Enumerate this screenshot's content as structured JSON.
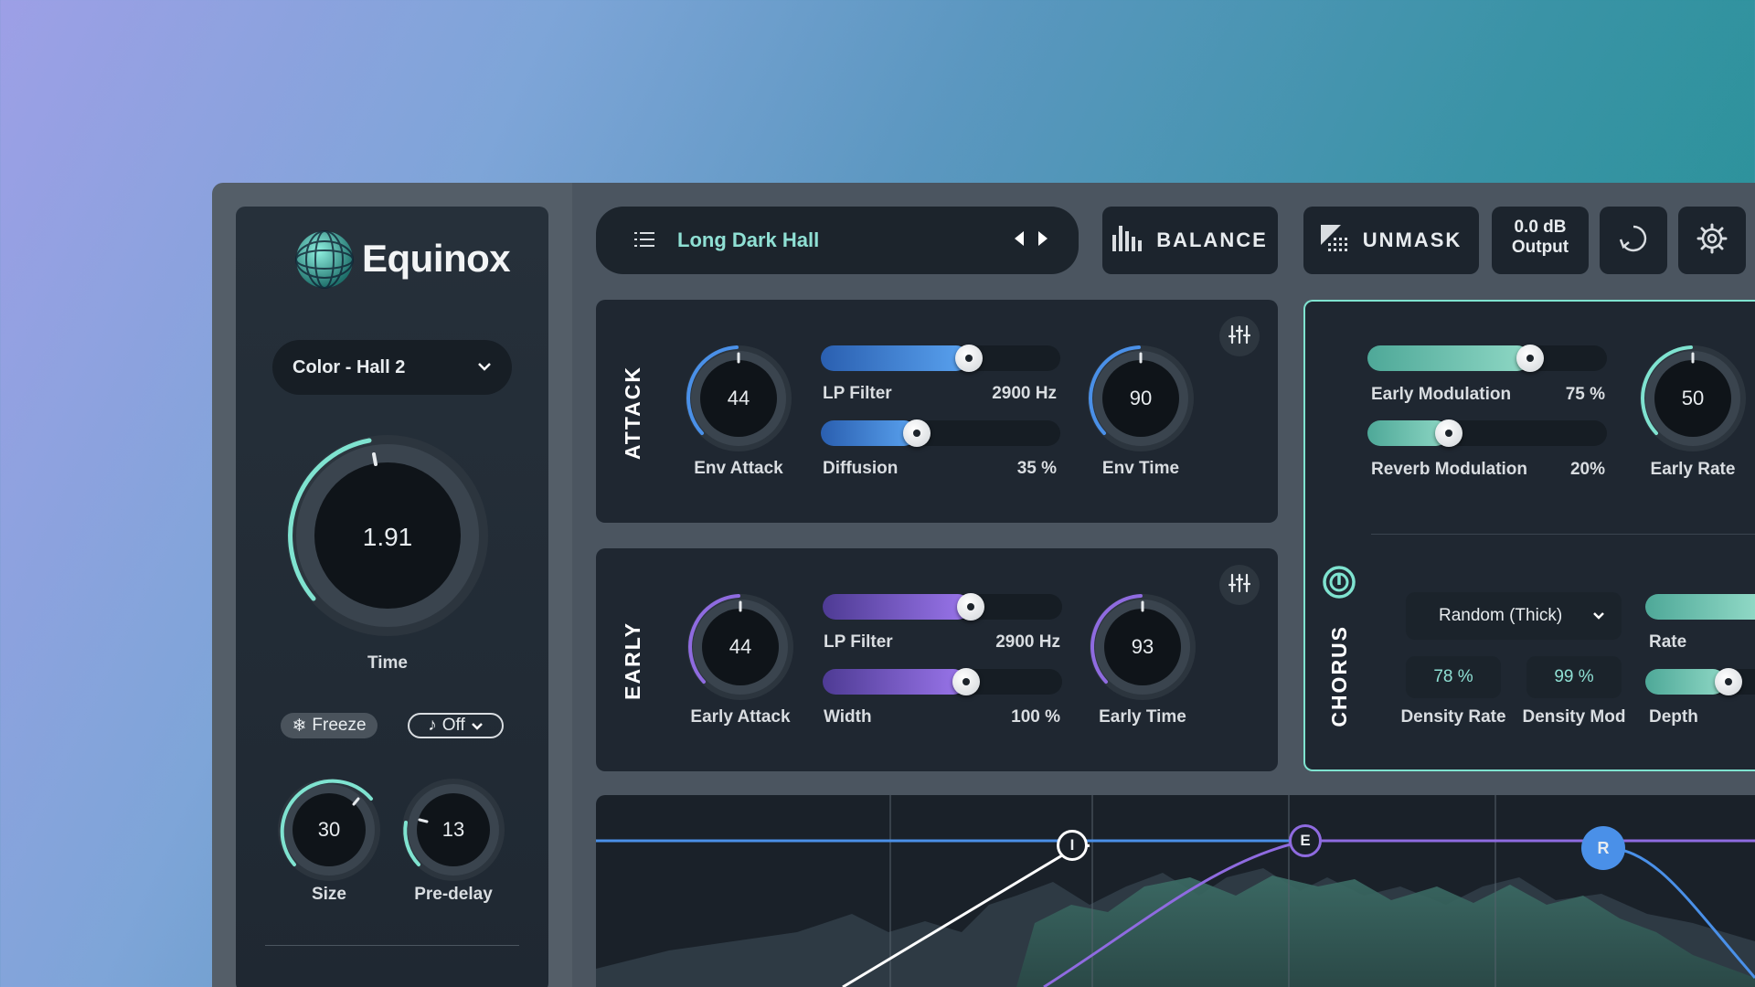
{
  "app": {
    "name": "Equinox"
  },
  "left": {
    "color_preset": "Color - Hall 2",
    "time": {
      "value": "1.91",
      "label": "Time"
    },
    "freeze_label": "Freeze",
    "sync_label": "Off",
    "size": {
      "value": "30",
      "label": "Size"
    },
    "predelay": {
      "value": "13",
      "label": "Pre-delay"
    }
  },
  "topbar": {
    "preset_name": "Long Dark Hall",
    "balance_label": "BALANCE",
    "unmask_label": "UNMASK",
    "output_value": "0.0 dB",
    "output_label": "Output"
  },
  "attack": {
    "title": "ATTACK",
    "env_attack": {
      "value": "44",
      "label": "Env Attack"
    },
    "lp_filter": {
      "label": "LP Filter",
      "value": "2900 Hz",
      "level": 0.62
    },
    "diffusion": {
      "label": "Diffusion",
      "value": "35 %",
      "level": 0.4
    },
    "env_time": {
      "value": "90",
      "label": "Env Time"
    }
  },
  "early": {
    "title": "EARLY",
    "early_attack": {
      "value": "44",
      "label": "Early Attack"
    },
    "lp_filter": {
      "label": "LP Filter",
      "value": "2900 Hz",
      "level": 0.62
    },
    "width": {
      "label": "Width",
      "value": "100 %",
      "level": 0.6
    },
    "early_time": {
      "value": "93",
      "label": "Early Time"
    }
  },
  "chorus": {
    "title": "CHORUS",
    "early_modulation": {
      "label": "Early Modulation",
      "value": "75 %",
      "level": 0.68
    },
    "reverb_modulation": {
      "label": "Reverb Modulation",
      "value": "20%",
      "level": 0.34
    },
    "early_rate": {
      "value": "50",
      "label": "Early Rate"
    },
    "mode": "Random (Thick)",
    "density_rate": {
      "value": "78 %",
      "label": "Density Rate"
    },
    "density_mod": {
      "value": "99 %",
      "label": "Density Mod"
    },
    "rate_label": "Rate",
    "depth_label": "Depth"
  },
  "envelope": {
    "nodes": [
      "I",
      "E",
      "R"
    ]
  },
  "colors": {
    "accent_teal": "#7fe3d0",
    "accent_blue": "#4a90e8",
    "accent_purple": "#8f6be0"
  }
}
